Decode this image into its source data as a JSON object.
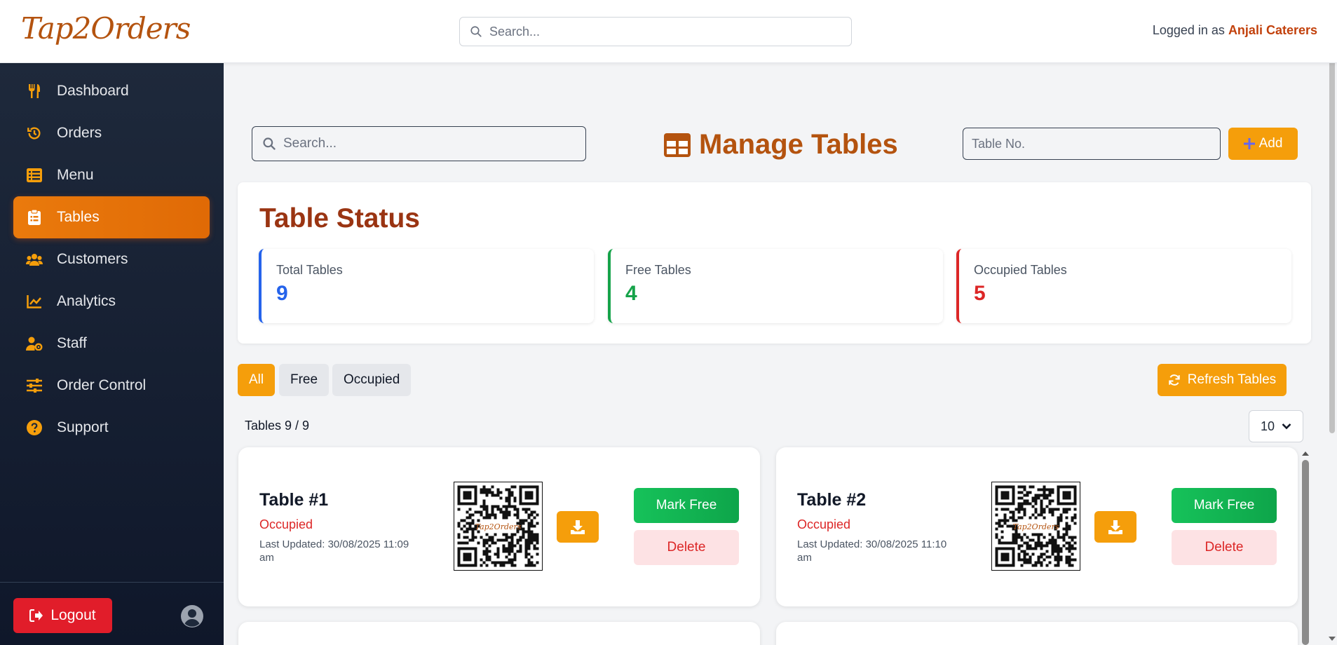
{
  "header": {
    "logo": "Tap2Orders",
    "search_placeholder": "Search...",
    "logged_prefix": "Logged in as",
    "logged_user": "Anjali Caterers"
  },
  "sidebar": {
    "items": [
      {
        "label": "Dashboard",
        "icon": "utensils-icon"
      },
      {
        "label": "Orders",
        "icon": "history-icon"
      },
      {
        "label": "Menu",
        "icon": "list-icon"
      },
      {
        "label": "Tables",
        "icon": "clipboard-icon",
        "active": true
      },
      {
        "label": "Customers",
        "icon": "users-icon"
      },
      {
        "label": "Analytics",
        "icon": "chart-line-icon"
      },
      {
        "label": "Staff",
        "icon": "user-gear-icon"
      },
      {
        "label": "Order Control",
        "icon": "sliders-icon"
      },
      {
        "label": "Support",
        "icon": "question-circle-icon"
      }
    ],
    "logout_label": "Logout"
  },
  "main": {
    "search_placeholder": "Search...",
    "title": "Manage Tables",
    "table_no_placeholder": "Table No.",
    "add_label": "Add",
    "status": {
      "title": "Table Status",
      "stats": [
        {
          "label": "Total Tables",
          "value": "9",
          "color": "#2563eb"
        },
        {
          "label": "Free Tables",
          "value": "4",
          "color": "#16a34a"
        },
        {
          "label": "Occupied Tables",
          "value": "5",
          "color": "#dc2626"
        }
      ]
    },
    "filters": [
      "All",
      "Free",
      "Occupied"
    ],
    "active_filter": "All",
    "refresh_label": "Refresh Tables",
    "count_text": "Tables 9 / 9",
    "per_page": "10",
    "tables": [
      {
        "name": "Table #1",
        "status": "Occupied",
        "updated": "Last Updated: 30/08/2025 11:09 am",
        "free_label": "Mark Free",
        "delete_label": "Delete"
      },
      {
        "name": "Table #2",
        "status": "Occupied",
        "updated": "Last Updated: 30/08/2025 11:10 am",
        "free_label": "Mark Free",
        "delete_label": "Delete"
      }
    ]
  },
  "colors": {
    "accent": "#f59e0b",
    "brand": "#b4530f",
    "sidebar_bg": "#1e293b",
    "active_nav": "#ea7a0c"
  }
}
